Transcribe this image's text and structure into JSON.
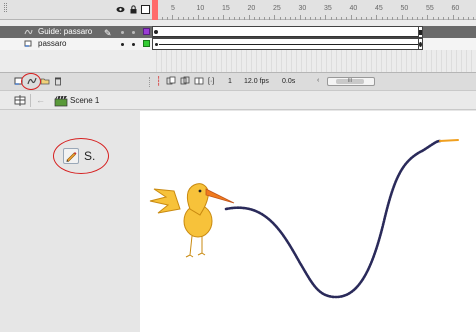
{
  "timeline": {
    "ruler_ticks": [
      "5",
      "10",
      "15",
      "20",
      "25",
      "30",
      "35",
      "40",
      "45",
      "50",
      "55",
      "60"
    ],
    "header_icons": [
      "eye-icon",
      "lock-icon",
      "outline-icon"
    ],
    "layers": [
      {
        "name": "Guide: passaro",
        "type": "motion-guide",
        "selected": true,
        "outline_color": "#9b3bd6"
      },
      {
        "name": "passaro",
        "type": "normal",
        "selected": false,
        "outline_color": "#33cc33"
      }
    ],
    "footer": {
      "current_frame": "1",
      "fps": "12.0 fps",
      "time": "0.0s"
    }
  },
  "edit_bar": {
    "scene_name": "Scene 1"
  },
  "tools": {
    "label": "S."
  },
  "colors": {
    "playhead": "#ff6a6a",
    "guide_path": "#2a2a5a",
    "annotation": "#d62020",
    "bird_body": "#f7c23a",
    "bird_beak": "#f07a1e"
  }
}
